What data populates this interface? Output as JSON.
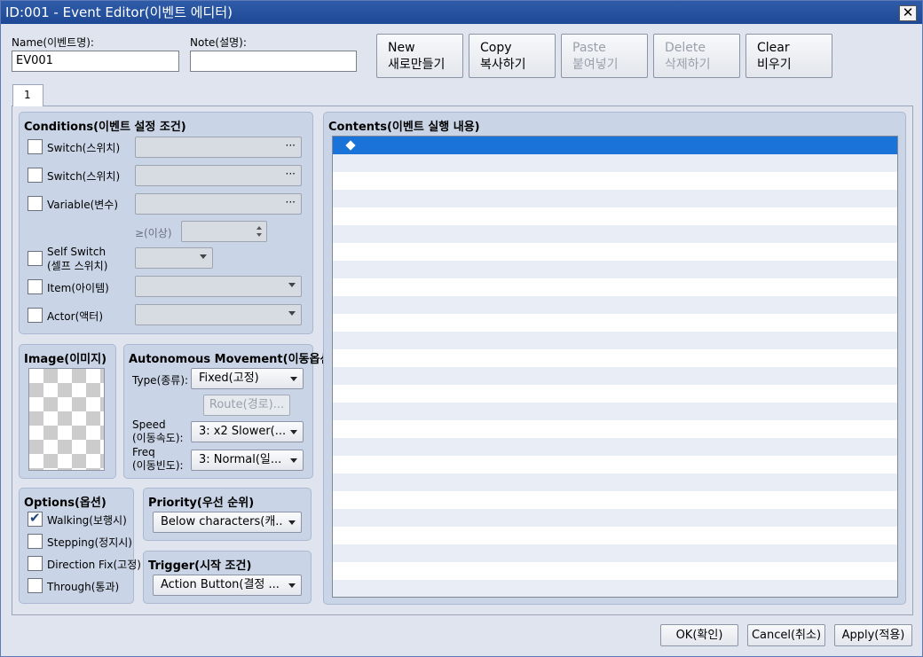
{
  "window": {
    "title": "ID:001 - Event Editor(이벤트 에디터)",
    "close_glyph": "✕"
  },
  "fields": {
    "name_label": "Name(이벤트명):",
    "name_value": "EV001",
    "note_label": "Note(설명):",
    "note_value": ""
  },
  "toolbar": {
    "new": [
      "New",
      "새로만들기"
    ],
    "copy": [
      "Copy",
      "복사하기"
    ],
    "paste": [
      "Paste",
      "붙여넣기"
    ],
    "delete": [
      "Delete",
      "삭제하기"
    ],
    "clear": [
      "Clear",
      "비우기"
    ]
  },
  "tabs": [
    "1"
  ],
  "conditions": {
    "title": "Conditions(이벤트 설정 조건)",
    "switch1": "Switch(스위치)",
    "switch2": "Switch(스위치)",
    "variable": "Variable(변수)",
    "gte": "≥(이상)",
    "self_switch": [
      "Self Switch",
      "(셀프 스위치)"
    ],
    "item": "Item(아이템)",
    "actor": "Actor(액터)",
    "ellipsis": "···"
  },
  "image": {
    "title": "Image(이미지)"
  },
  "movement": {
    "title": "Autonomous Movement(이동옵션)",
    "type_label": "Type(종류):",
    "type_value": "Fixed(고정)",
    "route_button": "Route(경로)...",
    "speed_label": [
      "Speed",
      "(이동속도):"
    ],
    "speed_value": "3: x2 Slower(...",
    "freq_label": [
      "Freq",
      "(이동빈도):"
    ],
    "freq_value": "3: Normal(일..."
  },
  "options": {
    "title": "Options(옵션)",
    "walking": "Walking(보행시)",
    "walking_checked": true,
    "stepping": "Stepping(정지시)",
    "direction_fix": "Direction Fix(고정)",
    "through": "Through(통과)"
  },
  "priority": {
    "title": "Priority(우선 순위)",
    "value": "Below characters(캐..."
  },
  "trigger": {
    "title": "Trigger(시작 조건)",
    "value": "Action Button(결정 ..."
  },
  "contents": {
    "title": "Contents(이벤트 실행 내용)",
    "selected_color": "#1a73d9"
  },
  "footer": {
    "ok": "OK(확인)",
    "cancel": "Cancel(취소)",
    "apply": "Apply(적용)"
  },
  "colors": {
    "titlebar": "#1e4895",
    "group_bg": "#c9d4e6",
    "window_bg": "#dfe4ee"
  }
}
